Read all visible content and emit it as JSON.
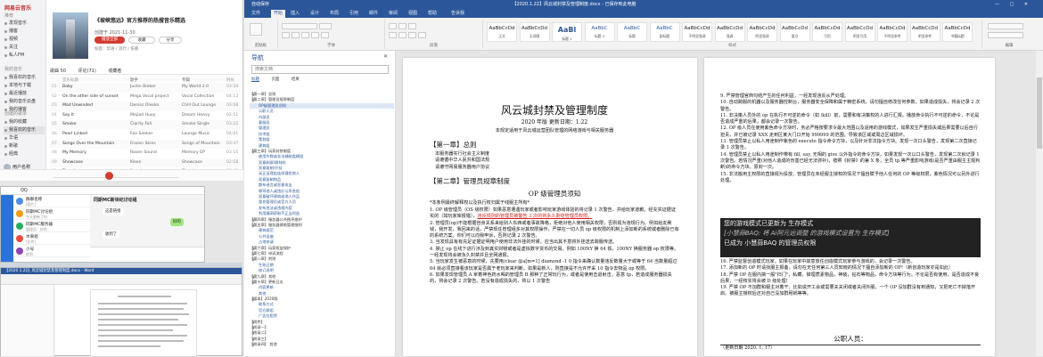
{
  "music": {
    "logo": "网易云音乐",
    "sections": [
      "推荐",
      "我的音乐",
      "创建的歌单",
      "收藏的歌单"
    ],
    "sidebar_items": [
      "发现音乐",
      "播客",
      "视频",
      "关注",
      "私人FM",
      "我喜欢的音乐",
      "本地与下载",
      "最近播放",
      "我的音乐云盘",
      "我的播客",
      "我的收藏",
      "我喜欢的音乐",
      "华语",
      "新歌",
      "经典"
    ],
    "user_name": "用户名称",
    "playlist_title": "《坡峡悠远》官方推荐的热搜音乐精选",
    "playlist_meta": "创建于 2021-11-30",
    "playlist_desc": "标签：华语 / 流行 / 伤感",
    "play_all": "播放全部",
    "collect": "收藏",
    "share": "分享",
    "tabs": [
      "歌曲 50",
      "评论(71)",
      "收藏者"
    ],
    "song_headers": [
      "音乐标题",
      "歌手",
      "专辑",
      "时长"
    ],
    "songs": [
      {
        "no": "01",
        "title": "Baby",
        "artist": "Justin Bieber",
        "album": "My World 2.0",
        "dur": "03:34"
      },
      {
        "no": "02",
        "title": "On the other side of sunset",
        "artist": "Mega Vocal project",
        "album": "Vocal Collection",
        "dur": "04:12"
      },
      {
        "no": "03",
        "title": "Mad Unwinded",
        "artist": "Deniss Olesko",
        "album": "Chill Out Lounge",
        "dur": "03:08"
      },
      {
        "no": "04",
        "title": "Say It",
        "artist": "Mejiad Huoy",
        "album": "Dream Heavy",
        "dur": "02:51"
      },
      {
        "no": "05",
        "title": "Smoke",
        "artist": "Clarity Fall",
        "album": "Smoke Single",
        "dur": "03:22"
      },
      {
        "no": "06",
        "title": "Pearl Linked",
        "artist": "Foo Seeker",
        "album": "Lounge Music",
        "dur": "04:01"
      },
      {
        "no": "07",
        "title": "Songs Over the Mountain",
        "artist": "Frozen Skies",
        "album": "Songs of Mountain",
        "dur": "03:47"
      },
      {
        "no": "08",
        "title": "My Memory",
        "artist": "Rosen Sound",
        "album": "Memory EP",
        "dur": "03:15"
      },
      {
        "no": "09",
        "title": "Showcase",
        "artist": "Kiken",
        "album": "Showcase",
        "dur": "02:58"
      },
      {
        "no": "10",
        "title": "Elsewhere",
        "artist": "Novel",
        "album": "Elsewhere",
        "dur": "03:40"
      }
    ]
  },
  "chat": {
    "title": "QQ",
    "window_title": "同斯MC新世纪讨论组",
    "conversations": [
      {
        "name": "群聊名称",
        "msg": "[图片]",
        "color": "#4a90e2"
      },
      {
        "name": "同斯MC讨论组",
        "msg": "今天更新了吗",
        "color": "#f39c12"
      },
      {
        "name": "同斯MC服务器",
        "msg": "管理员：好的",
        "color": "#27ae60"
      },
      {
        "name": "水果组",
        "msg": "[文件]",
        "color": "#e74c3c"
      },
      {
        "name": "小号",
        "msg": "收到",
        "color": "#8e44ad"
      }
    ],
    "bubbles": [
      "这是链接",
      "好的",
      "收到了"
    ],
    "back_title": "同斯MC服务器讨论群"
  },
  "lowwin": {
    "title": "【2020.1.22】风云城封禁及管理制度.docx - Word"
  },
  "word": {
    "title": "【2020.1.22】风云城封禁及管理制度.docx - 已保存到此电脑",
    "autosave": "自动保存",
    "window_controls": "— □ ✕",
    "tabs": [
      "文件",
      "开始",
      "插入",
      "设计",
      "布局",
      "引用",
      "邮件",
      "审阅",
      "视图",
      "帮助",
      "告诉我"
    ],
    "styles": [
      {
        "sample": "AaBbCcDd",
        "name": "正文"
      },
      {
        "sample": "AaBbCcDd",
        "name": "无间隔"
      },
      {
        "sample": "AaBl",
        "name": "标题 1"
      },
      {
        "sample": "AaBbC",
        "name": "标题 2"
      },
      {
        "sample": "AaBbC",
        "name": "标题"
      },
      {
        "sample": "AaBbC",
        "name": "副标题"
      },
      {
        "sample": "AaBbCcDd",
        "name": "不明显强调"
      },
      {
        "sample": "AaBbCcDd",
        "name": "强调"
      },
      {
        "sample": "AaBbCcDd",
        "name": "明显强调"
      },
      {
        "sample": "AaBbCcDd",
        "name": "要点"
      },
      {
        "sample": "AaBbCcDd",
        "name": "引用"
      },
      {
        "sample": "AaBbCcDd",
        "name": "明显引用"
      },
      {
        "sample": "AaBbCcDd",
        "name": "不明显参考"
      },
      {
        "sample": "AaBbCcDd",
        "name": "明显参考"
      },
      {
        "sample": "AaBbCcDd",
        "name": "书籍标题"
      }
    ],
    "group_labels": [
      "剪贴板",
      "字体",
      "段落",
      "样式",
      "编辑"
    ]
  },
  "nav": {
    "header": "导航",
    "close": "✕",
    "search_placeholder": "搜索文档",
    "tabs": [
      "标题",
      "页面",
      "结果"
    ],
    "items": [
      {
        "text": "【第一章】总则",
        "level": 0
      },
      {
        "text": "【第二章】管理员规章制度",
        "level": 0
      },
      {
        "text": "OP级管理员须知",
        "level": 1,
        "on": true
      },
      {
        "text": "公职人员",
        "level": 1
      },
      {
        "text": "内部员",
        "level": 1
      },
      {
        "text": "客服员",
        "level": 1
      },
      {
        "text": "管理员",
        "level": 1
      },
      {
        "text": "技术组",
        "level": 1
      },
      {
        "text": "策划组",
        "level": 1
      },
      {
        "text": "建筑组",
        "level": 1
      },
      {
        "text": "【第三章】玩家封禁制度",
        "level": 0
      },
      {
        "text": "使用作弊或非法辅助类模组",
        "level": 1
      },
      {
        "text": "恶意刷屏/刷材料",
        "level": 1
      },
      {
        "text": "恶意复制/开挂",
        "level": 1
      },
      {
        "text": "无正当理由连续骚扰他人",
        "level": 1
      },
      {
        "text": "恶意复制物品",
        "level": 1
      },
      {
        "text": "散布谣言或恶意攻击",
        "level": 1
      },
      {
        "text": "辱骂他人或违反公序良俗",
        "level": 1
      },
      {
        "text": "恶意破坏建筑或他人作品",
        "level": 1
      },
      {
        "text": "冒充管理员或官方人员",
        "level": 1
      },
      {
        "text": "发布违法或违规内容",
        "level": 1
      },
      {
        "text": "利用漏洞获取不正当利益",
        "level": 1
      },
      {
        "text": "【第四章】服务器公共秩序维护",
        "level": 0
      },
      {
        "text": "【第五章】服务器建筑管理细则",
        "level": 0
      },
      {
        "text": "建筑规范",
        "level": 1
      },
      {
        "text": "公共设施",
        "level": 1
      },
      {
        "text": "占地申请",
        "level": 1
      },
      {
        "text": "【第六章】玩家权益保护",
        "level": 0
      },
      {
        "text": "【第七章】申诉流程",
        "level": 0
      },
      {
        "text": "【第八章】附则",
        "level": 0
      },
      {
        "text": "生效日期",
        "level": 1
      },
      {
        "text": "修订说明",
        "level": 1
      },
      {
        "text": "【第九章】其他",
        "level": 0
      },
      {
        "text": "【第十章】更新日志",
        "level": 0
      },
      {
        "text": "内容更新",
        "level": 1
      },
      {
        "text": "其他",
        "level": 1
      },
      {
        "text": "【版本】2020版",
        "level": 0
      },
      {
        "text": "联系方式",
        "level": 1
      },
      {
        "text": "官方群组",
        "level": 1
      },
      {
        "text": "广告位租赁",
        "level": 1
      },
      {
        "text": "【附件】",
        "level": 0
      },
      {
        "text": "【附录一】",
        "level": 0
      },
      {
        "text": "【附录二】",
        "level": 0
      },
      {
        "text": "【附录三】",
        "level": 0
      },
      {
        "text": "【附录四】 其他",
        "level": 0
      }
    ]
  },
  "page1": {
    "title": "风云城封禁及管理制度",
    "version": "2020 年版  更新日期：1.22",
    "intro": "本规定适用于风云城运营团队管理的网络游戏与相关服务器",
    "ch1": "【第一章】总则",
    "ch1_bullets": [
      "本服务器实行社会主义制度",
      "请遵循中华人民共和国法规",
      "请遵守网易服务器用户协议"
    ],
    "ch2": "【第二章】管理员规章制度",
    "op_heading": "OP 级管理员须知",
    "op_intro": "*本条例最终解释权以及执行权归属于线服主所有*",
    "paragraphs": [
      {
        "pre": "1. OP 级管理员（OS 级权限）如果恶意遭遇玩家或者影响玩家游戏体验的将记录 1 次警告，并给玩家道歉。经充实证据证实的（如玩家库报错），",
        "red": "违反规则的管理员被警告 3 次的将永久剥夺管理员权限。"
      },
      {
        "pre": "2. 管理员(op)不能根据自身关系来给别人东西或者事故降格，拒绝对他人使用相关权限，否则视为违规行为。例如给友刷钱，我开发，我回来的话，严禁现任管理组多对其权限操作，严禁在一切人员 op 级权限的机制上添加新的系统或者删除已有的系统方案。你们可以向我申诉，否则记录 2 次警告。",
        "red": ""
      },
      {
        "pre": "3. 当发现具有有充足证据证明用户使用非法外挂的时候，应当出其不意将外挂送去跨服传送。",
        "red": ""
      },
      {
        "pre": "4. 禁止 op 在线下进行涉及到真实财物或者是虚拟数字货币的交易。例如 100NY 换 64 铁，100NY 换服务器 op 权限等。一经发现将会被永久封禁并且全网通报。",
        "red": ""
      },
      {
        "pre": "5. 当玩家发生被恶意的时候，先要用/clear @a[m=1] diamond -1 0 指令来确认数量违反数量大于或等于 64 当数量超过 64 就必须直接看该玩家是否属于老玩家来判断。如果是新人，则直接是不允许开采 10 指令去物品 op 权限。",
        "red": ""
      },
      {
        "pre": "6. 如果发现管理员 A 拿着神色药水喝的管理员 B 那种了正常玩行为，或者是使用击退射击，恶意 tp，若造成服务器损失的，将会记录 2 次警告。若没有造成损失的，将以 1 次警告",
        "red": ""
      }
    ]
  },
  "page2": {
    "paragraphs": [
      "9. 严禁管理官商勾结产生的任何利益，一经发现违反从严处理。",
      "10. 自动跨服的机器以及服务器控制台，服务器安全保障和属于精密系统，请勿擅自修改任何参数，如果造成损失，将会记录 2 次警告。",
      "11. 非决策人员外的 op 在执行不可逆的命令（如 /kill）前，需要和有决策权的人进行汇报。播放命令执行不可逆的命令，不论是否造成严重的后果，都会记录一次警告。",
      "12. OP 级人员在使用紫色命令方块时，务必严格按要求令最大范围以及适用的游戏模式，如果发生严重损失或后果需要以后自行担责，并已被记录 XXX 走到区某大门口开始 999999 的范围，导致该区域或周边区域损坏。",
      "13. 管理员禁止以私人用途制作紫色的 execute 指令命令方块，以及针对非法指令方块。发现一次口头警告，发现第二次直接记录 1 次警告。",
      "14. 管理员禁止以私人用途制作带有 fill, say, 无相的 give 以外指令的命令方块，如果发现一次以口头警告，发现第二次就记录 1 次警告。若情况严重(对他人造成的伤害已经无法弥补)，按照《封禁》的第 X 条，全员 tp 等严重影响游戏(是否严重由服主主观判断)的命令方块，原封一次。",
      "15. 非法搬用主权限的直接视为投放，管理员在未经服主授权的情况下擅自赋予他人任何的 OP 等级权限，紫色情况可以另外进行处理。"
    ],
    "quote_lines": [
      "您的游戏模式已更新为 生存模式",
      "[小慧蒜BAQ: 将 Ai阿元远调整 的游戏模式设置为 生存模式]",
      "已成为 小慧蒜BAQ 的管理员权限"
    ],
    "paragraphs_after": [
      "16. 严禁监督创造模式玩家，如果在玩家中故意放任创造模式玩家参与游戏的，会记录一次警告。",
      "17. 添加新的 OP 时请找服主报备，请勿在无任何第三人员知晓的情况下擅自添加新的 OP!（新创造玩家亦是如此）",
      "18. 严禁 OP 在服内搞一般\"扫门\"，私藏，掉埋质素物品，神装，钻石等物品，命令方块等行为。不论是否有使用，是否造成不良后果，一经核实将会被 D 级处理!",
      "19. 严禁 OP 不加群和服主对着干。比如说开工会或需要关关闭或者关闭外服，一个 OP 没加群没有到通知，又把死亡不掉落开启。被服主授权后还对自己没加群甩锅等等。"
    ],
    "public_heading": "公职人员：",
    "footer_line": "（更新日期 2020. 1. 17）"
  }
}
